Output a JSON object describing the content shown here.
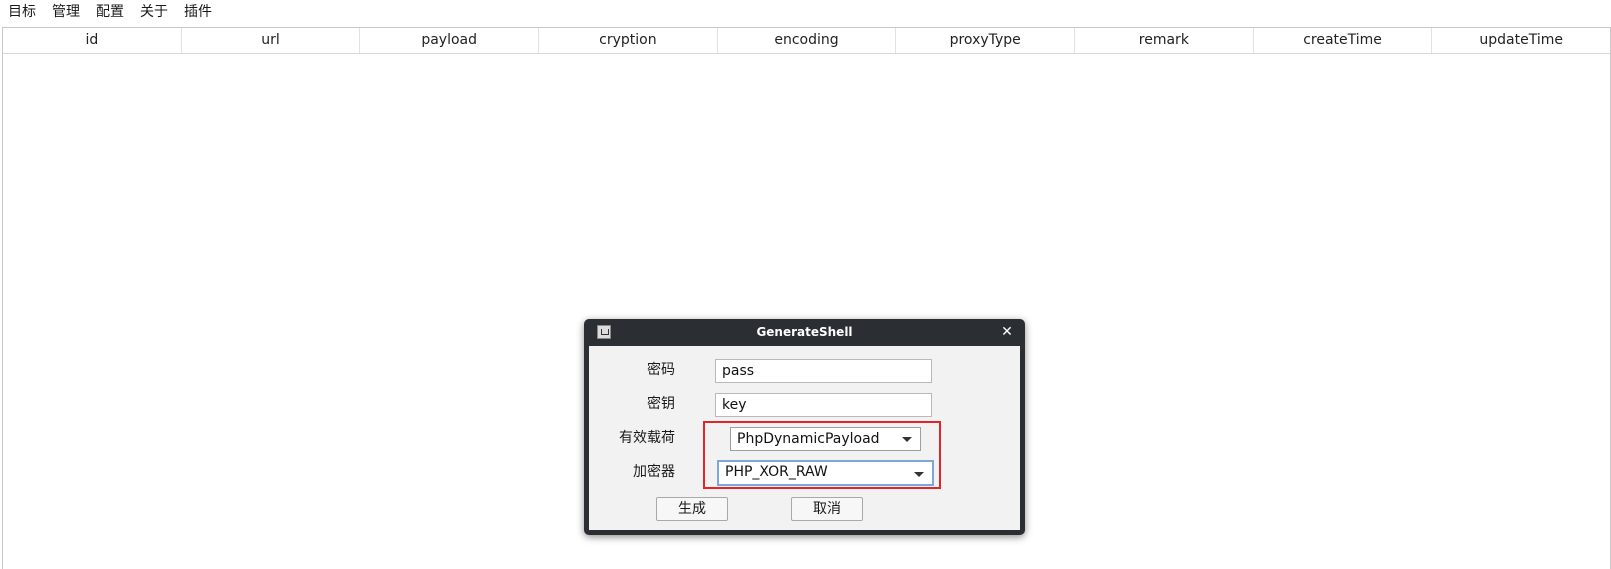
{
  "menu": {
    "items": [
      "目标",
      "管理",
      "配置",
      "关于",
      "插件"
    ]
  },
  "table": {
    "columns": [
      "id",
      "url",
      "payload",
      "cryption",
      "encoding",
      "proxyType",
      "remark",
      "createTime",
      "updateTime"
    ]
  },
  "dialog": {
    "title": "GenerateShell",
    "password_label": "密码",
    "password_value": "pass",
    "key_label": "密钥",
    "key_value": "key",
    "payload_label": "有效载荷",
    "payload_selected": "PhpDynamicPayload",
    "cryption_label": "加密器",
    "cryption_selected": "PHP_XOR_RAW",
    "generate_label": "生成",
    "cancel_label": "取消"
  },
  "colors": {
    "highlight": "#e3242b",
    "titlebar": "#2b2e33",
    "focus": "#7ea6d8"
  }
}
